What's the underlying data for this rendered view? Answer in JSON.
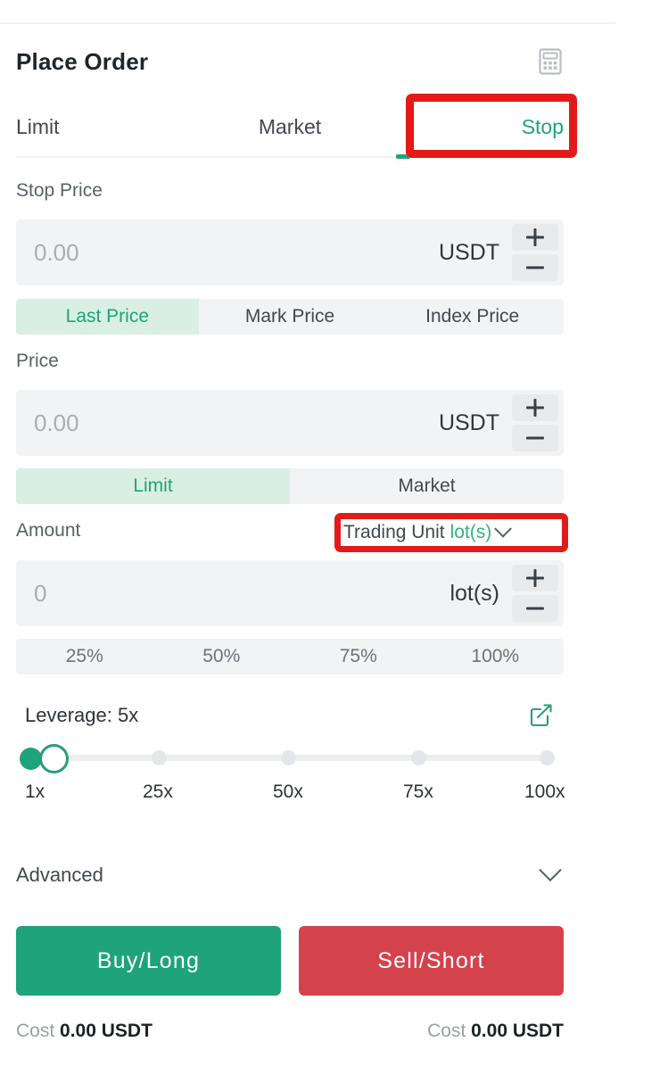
{
  "header": {
    "title": "Place Order",
    "calculator_icon": "calculator-icon"
  },
  "order_type_tabs": [
    {
      "label": "Limit",
      "active": false
    },
    {
      "label": "Market",
      "active": false
    },
    {
      "label": "Stop",
      "active": true
    }
  ],
  "stop_price": {
    "label": "Stop Price",
    "value": "",
    "placeholder": "0.00",
    "unit": "USDT",
    "increment_label": "+",
    "decrement_label": "−",
    "trigger_options": [
      {
        "label": "Last Price",
        "active": true
      },
      {
        "label": "Mark Price",
        "active": false
      },
      {
        "label": "Index Price",
        "active": false
      }
    ]
  },
  "price": {
    "label": "Price",
    "value": "",
    "placeholder": "0.00",
    "unit": "USDT",
    "increment_label": "+",
    "decrement_label": "−",
    "order_options": [
      {
        "label": "Limit",
        "active": true
      },
      {
        "label": "Market",
        "active": false
      }
    ]
  },
  "amount": {
    "label": "Amount",
    "unit_selector_label": "Trading Unit",
    "unit_selector_value": "lot(s)",
    "value": "",
    "placeholder": "0",
    "unit": "lot(s)",
    "increment_label": "+",
    "decrement_label": "−",
    "percentages": [
      "25%",
      "50%",
      "75%",
      "100%"
    ]
  },
  "leverage": {
    "title": "Leverage: 5x",
    "value": "5x",
    "edit_icon": "edit-icon",
    "ticks": [
      "1x",
      "25x",
      "50x",
      "75x",
      "100x"
    ],
    "min": 1,
    "max": 100,
    "current": 5
  },
  "advanced": {
    "label": "Advanced",
    "expanded": false,
    "chevron_icon": "chevron-down-icon"
  },
  "actions": {
    "buy_label": "Buy/Long",
    "sell_label": "Sell/Short",
    "buy_cost_key": "Cost",
    "buy_cost_value": "0.00 USDT",
    "sell_cost_key": "Cost",
    "sell_cost_value": "0.00 USDT"
  },
  "colors": {
    "accent_green": "#1fa37a",
    "accent_green_soft": "#d9efe4",
    "sell_red": "#d4434c",
    "annotation_red": "#e21b18",
    "field_bg": "#f2f3f5"
  }
}
